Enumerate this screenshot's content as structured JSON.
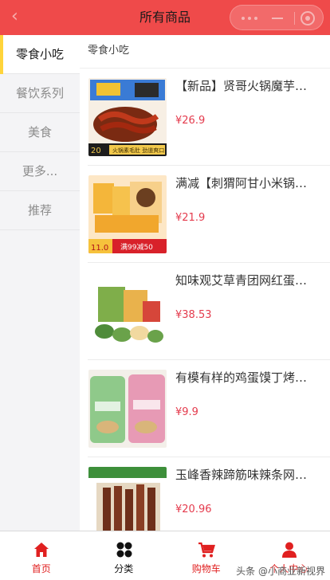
{
  "header": {
    "title": "所有商品",
    "back_icon": "back-arrow-icon",
    "capsule_icons": [
      "more-dots-icon",
      "minimize-icon",
      "close-circle-icon"
    ]
  },
  "sidebar": {
    "items": [
      {
        "label": "零食小吃",
        "active": true
      },
      {
        "label": "餐饮系列",
        "active": false
      },
      {
        "label": "美食",
        "active": false
      },
      {
        "label": "更多...",
        "active": false
      },
      {
        "label": "推荐",
        "active": false
      }
    ]
  },
  "main": {
    "section_title": "零食小吃",
    "products": [
      {
        "name": "【新品】贤哥火锅魔芋爽辣条素毛肚",
        "price": "¥26.9",
        "banner": "火锅素毛肚 劲道爽口",
        "badge": "20"
      },
      {
        "name": "满减【刺猬阿甘小米锅巴】",
        "price": "¥21.9",
        "banner": "满99减50",
        "badge": "11.0"
      },
      {
        "name": "知味观艾草青团网红蛋黄肉松",
        "price": "¥38.53",
        "banner": "",
        "badge": ""
      },
      {
        "name": "有模有样的鸡蛋馍丁烤馍片",
        "price": "¥9.9",
        "banner": "",
        "badge": ""
      },
      {
        "name": "玉峰香辣蹄筋味辣条网红零食",
        "price": "¥20.96",
        "banner": "",
        "badge": ""
      }
    ]
  },
  "tabbar": {
    "tabs": [
      {
        "label": "首页",
        "icon": "home-icon",
        "color": "#e02020"
      },
      {
        "label": "分类",
        "icon": "category-grid-icon",
        "color": "#111111"
      },
      {
        "label": "购物车",
        "icon": "cart-icon",
        "color": "#e02020"
      },
      {
        "label": "个人中心",
        "icon": "user-icon",
        "color": "#e02020"
      }
    ]
  },
  "watermark": "头条 @小商业新视界",
  "colors": {
    "header": "#ef4a4a",
    "accent": "#ffd43b",
    "price": "#e43b4d"
  }
}
